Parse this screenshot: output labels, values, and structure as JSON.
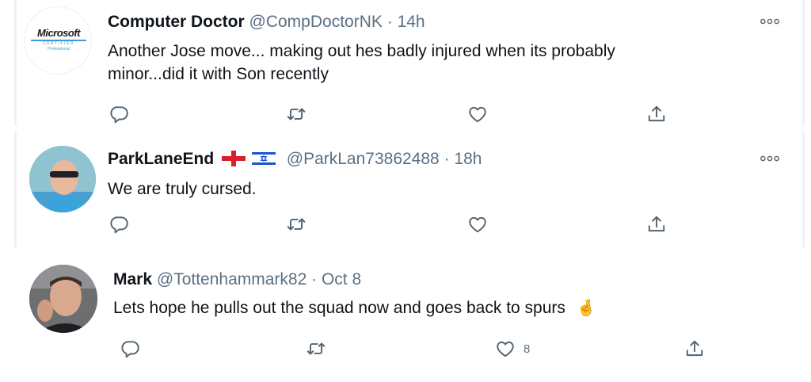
{
  "tweets": [
    {
      "name": "Computer Doctor",
      "handle": "@CompDoctorNK",
      "separator": "·",
      "time": "14h",
      "text_line1": "Another Jose move... making out hes badly injured when its probably",
      "text_line2": "minor...did it with Son recently",
      "avatar_logo": {
        "brand": "Microsoft",
        "line2": "CERTIFIED",
        "line3": "Professional"
      },
      "icons": [
        "reply-icon",
        "retweet-icon",
        "like-icon",
        "share-icon",
        "more-icon"
      ]
    },
    {
      "name": "ParkLaneEnd",
      "flags": [
        "england-flag-icon",
        "israel-flag-icon"
      ],
      "handle": "@ParkLan73862488",
      "separator": "·",
      "time": "18h",
      "text_line1": "We are truly cursed.",
      "icons": [
        "reply-icon",
        "retweet-icon",
        "like-icon",
        "share-icon",
        "more-icon"
      ]
    },
    {
      "name": "Mark",
      "handle": "@Tottenhammark82",
      "separator": "·",
      "time": "Oct 8",
      "text_line1": "Lets hope he pulls out the squad now and goes back to spurs",
      "emoji": "🤞",
      "like_count": "8",
      "icons": [
        "reply-icon",
        "retweet-icon",
        "like-icon",
        "share-icon"
      ]
    }
  ],
  "colors": {
    "text": "#0f1419",
    "secondary": "#5b7083",
    "icon": "#536471",
    "divider": "#eef1f4"
  }
}
